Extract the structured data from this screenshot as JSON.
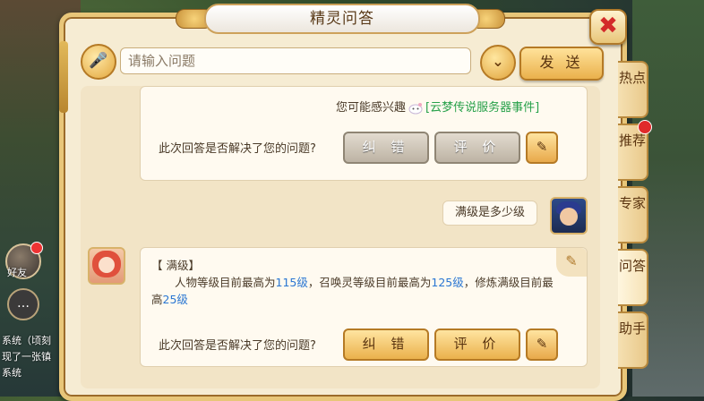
{
  "window": {
    "title": "精灵问答",
    "close_symbol": "✖"
  },
  "background": {
    "friend_label": "好友",
    "chat_lines": [
      "系统（顷刻",
      "现了一张镇",
      "系统"
    ]
  },
  "input_row": {
    "mic_symbol": "🎤",
    "placeholder": "请输入问题",
    "value": "",
    "dropdown_symbol": "⌄",
    "send_label": "发 送"
  },
  "messages": {
    "suggestion": {
      "prefix": "您可能感兴趣",
      "link": "[云梦传说服务器事件]"
    },
    "feedback_question": "此次回答是否解决了您的问题?",
    "correct_label": "纠 错",
    "rate_label": "评 价",
    "edit_symbol": "✎",
    "user_question": "满级是多少级",
    "answer": {
      "head": "【 满级】",
      "line_pre": "人物等级目前最高为",
      "num1": "115级",
      "line_mid1": "，召唤灵等级目前最高为",
      "num2": "125级",
      "line_mid2": "，修炼满级目前最高",
      "num3": "25级",
      "note_symbol": "✎"
    }
  },
  "tabs": [
    {
      "label": "热点"
    },
    {
      "label": "推荐",
      "badge": true
    },
    {
      "label": "专家"
    },
    {
      "label": "问答",
      "active": true
    },
    {
      "label": "助手"
    }
  ],
  "colors": {
    "accent_gold": "#eab14c",
    "link_green": "#27a14a",
    "number_blue": "#2a76d2",
    "close_red": "#d32a2a"
  }
}
